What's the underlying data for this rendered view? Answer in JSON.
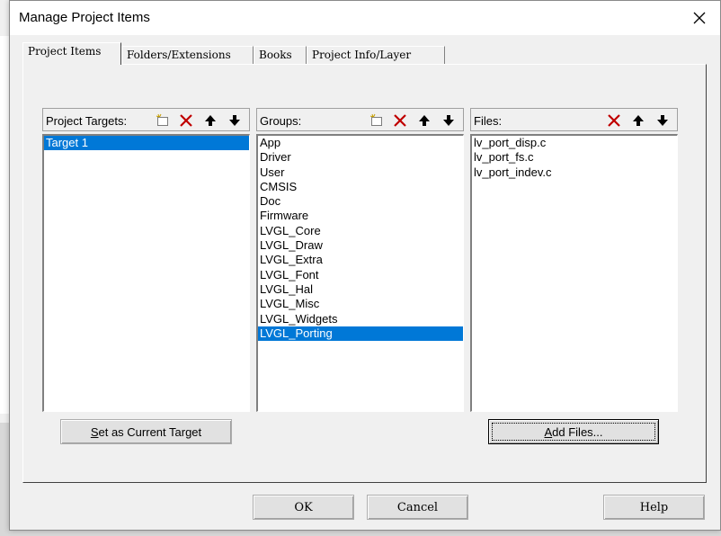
{
  "dialog": {
    "title": "Manage Project Items",
    "close_icon": "close-icon"
  },
  "tabs": [
    {
      "label": "Project Items",
      "active": true
    },
    {
      "label": "Folders/Extensions",
      "active": false
    },
    {
      "label": "Books",
      "active": false
    },
    {
      "label": "Project Info/Layer",
      "active": false
    }
  ],
  "targets": {
    "label": "Project Targets:",
    "items": [
      "Target 1"
    ],
    "selected": "Target 1",
    "tools": [
      "new-icon",
      "delete-icon",
      "move-up-icon",
      "move-down-icon"
    ]
  },
  "groups": {
    "label": "Groups:",
    "items": [
      "App",
      "Driver",
      "User",
      "CMSIS",
      "Doc",
      "Firmware",
      "LVGL_Core",
      "LVGL_Draw",
      "LVGL_Extra",
      "LVGL_Font",
      "LVGL_Hal",
      "LVGL_Misc",
      "LVGL_Widgets",
      "LVGL_Porting"
    ],
    "selected": "LVGL_Porting",
    "tools": [
      "new-icon",
      "delete-icon",
      "move-up-icon",
      "move-down-icon"
    ]
  },
  "files": {
    "label": "Files:",
    "items": [
      "lv_port_disp.c",
      "lv_port_fs.c",
      "lv_port_indev.c"
    ],
    "tools": [
      "delete-icon",
      "move-up-icon",
      "move-down-icon"
    ]
  },
  "buttons": {
    "set_current_target": "Set as Current Target",
    "add_files": "Add Files...",
    "ok": "OK",
    "cancel": "Cancel",
    "help": "Help"
  },
  "colors": {
    "selection": "#0078d7",
    "dialog_bg": "#f0f0f0",
    "delete_red": "#c00000"
  }
}
